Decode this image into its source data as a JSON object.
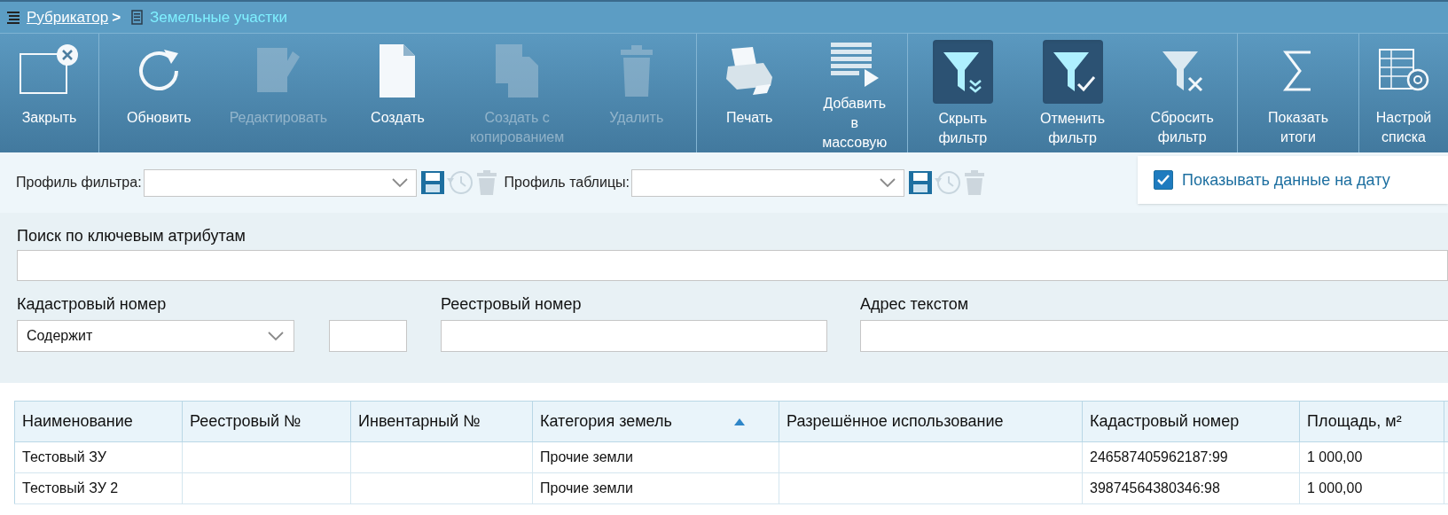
{
  "breadcrumb": {
    "parent": "Рубрикатор",
    "separator": ">",
    "current": "Земельные участки"
  },
  "toolbar": {
    "groups": [
      [
        {
          "label": "Закрыть",
          "disabled": false,
          "active": false
        }
      ],
      [
        {
          "label": "Обновить",
          "disabled": false,
          "active": false
        },
        {
          "label": "Редактировать",
          "disabled": true,
          "active": false
        },
        {
          "label": "Создать",
          "disabled": false,
          "active": false
        },
        {
          "label": "Создать с копированием",
          "disabled": true,
          "active": false
        },
        {
          "label": "Удалить",
          "disabled": true,
          "active": false
        }
      ],
      [
        {
          "label": "Печать",
          "disabled": false,
          "active": false
        },
        {
          "label": "Добавить в массовую",
          "disabled": false,
          "active": false
        }
      ],
      [
        {
          "label": "Скрыть фильтр",
          "disabled": false,
          "active": true
        },
        {
          "label": "Отменить фильтр",
          "disabled": false,
          "active": true
        },
        {
          "label": "Сбросить фильтр",
          "disabled": false,
          "active": false
        }
      ],
      [
        {
          "label": "Показать итоги",
          "disabled": false,
          "active": false
        }
      ],
      [
        {
          "label": "Настрой списка",
          "disabled": false,
          "active": false
        }
      ]
    ]
  },
  "profiles": [
    {
      "label": "Профиль фильтра:",
      "restore_disabled": true,
      "delete_disabled": true
    },
    {
      "label": "Профиль таблицы:",
      "restore_disabled": true,
      "delete_disabled": true
    }
  ],
  "show_on_date": {
    "label": "Показывать данные на дату",
    "checked": true
  },
  "search": {
    "label": "Поиск по ключевым атрибутам"
  },
  "fields": [
    {
      "kind": "select-input",
      "label": "Кадастровый номер",
      "value": "Содержит"
    },
    {
      "kind": "input",
      "label": "Реестровый номер"
    },
    {
      "kind": "input",
      "label": "Адрес текстом"
    }
  ],
  "table": {
    "columns": [
      {
        "label": "Наименование",
        "sorted": false
      },
      {
        "label": "Реестровый №",
        "sorted": false
      },
      {
        "label": "Инвентарный №",
        "sorted": false
      },
      {
        "label": "Категория земель",
        "sorted": true
      },
      {
        "label": "Разрешённое использование",
        "sorted": false
      },
      {
        "label": "Кадастровый номер",
        "sorted": false
      },
      {
        "label": "Площадь, м²",
        "sorted": false
      }
    ],
    "rows": [
      [
        "Тестовый ЗУ",
        "",
        "",
        "Прочие земли",
        "",
        "246587405962187:99",
        "1 000,00"
      ],
      [
        "Тестовый ЗУ 2",
        "",
        "",
        "Прочие земли",
        "",
        "39874564380346:98",
        "1 000,00"
      ]
    ]
  }
}
